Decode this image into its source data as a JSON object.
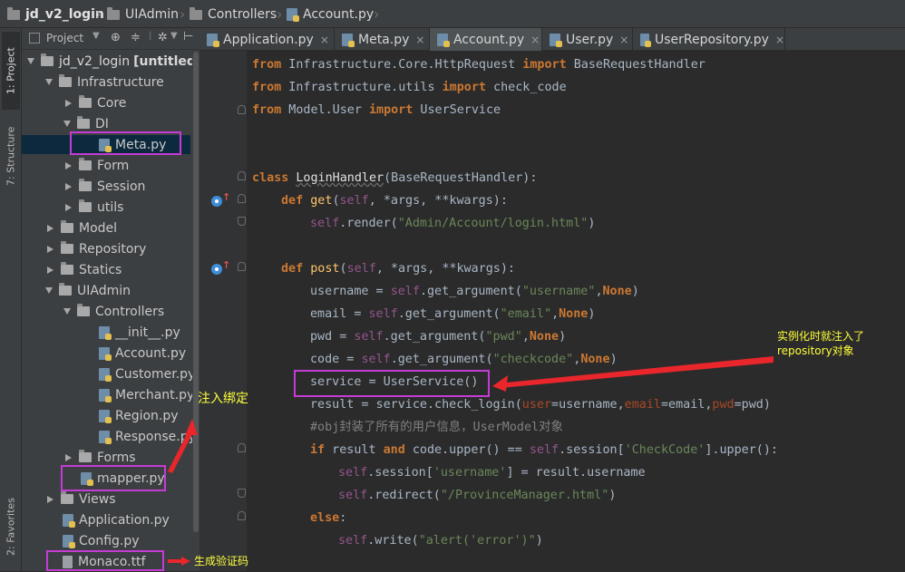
{
  "breadcrumb": [
    {
      "label": "jd_v2_login",
      "kind": "folder",
      "bold": true
    },
    {
      "label": "UIAdmin",
      "kind": "folder"
    },
    {
      "label": "Controllers",
      "kind": "folder"
    },
    {
      "label": "Account.py",
      "kind": "python-file"
    }
  ],
  "tool_stripe": {
    "project_tab": "1: Project",
    "structure_tab": "7: Structure",
    "favorites_tab": "2: Favorites"
  },
  "project_toolbar": {
    "label": "Project"
  },
  "tree": [
    {
      "label": "jd_v2_login",
      "suffix": "[untitled]",
      "type": "folder",
      "expanded": true
    },
    {
      "label": "Infrastructure",
      "type": "folder",
      "expanded": true
    },
    {
      "label": "Core",
      "type": "folder",
      "expanded": false
    },
    {
      "label": "DI",
      "type": "folder",
      "expanded": true
    },
    {
      "label": "Meta.py",
      "type": "python-file",
      "selected": true
    },
    {
      "label": "Form",
      "type": "folder",
      "expanded": false
    },
    {
      "label": "Session",
      "type": "folder",
      "expanded": false
    },
    {
      "label": "utils",
      "type": "folder",
      "expanded": false
    },
    {
      "label": "Model",
      "type": "folder",
      "expanded": false
    },
    {
      "label": "Repository",
      "type": "folder",
      "expanded": false
    },
    {
      "label": "Statics",
      "type": "folder",
      "expanded": false
    },
    {
      "label": "UIAdmin",
      "type": "folder",
      "expanded": true
    },
    {
      "label": "Controllers",
      "type": "folder",
      "expanded": true
    },
    {
      "label": "__init__.py",
      "type": "python-file"
    },
    {
      "label": "Account.py",
      "type": "python-file"
    },
    {
      "label": "Customer.py",
      "type": "python-file"
    },
    {
      "label": "Merchant.py",
      "type": "python-file"
    },
    {
      "label": "Region.py",
      "type": "python-file"
    },
    {
      "label": "Response.py",
      "type": "python-file"
    },
    {
      "label": "Forms",
      "type": "folder",
      "expanded": false
    },
    {
      "label": "mapper.py",
      "type": "python-file"
    },
    {
      "label": "Views",
      "type": "folder",
      "expanded": false
    },
    {
      "label": "Application.py",
      "type": "python-file"
    },
    {
      "label": "Config.py",
      "type": "python-file"
    },
    {
      "label": "Monaco.ttf",
      "type": "font-file"
    }
  ],
  "editor_tabs": [
    {
      "label": "Application.py",
      "active": false
    },
    {
      "label": "Meta.py",
      "active": false
    },
    {
      "label": "Account.py",
      "active": true
    },
    {
      "label": "User.py",
      "active": false
    },
    {
      "label": "UserRepository.py",
      "active": false
    }
  ],
  "tab_close_glyph": "×",
  "code": {
    "l1": {
      "kw1": "from",
      "mod": " Infrastructure.Core.HttpRequest ",
      "kw2": "import",
      "name": " BaseRequestHandler"
    },
    "l2": {
      "kw1": "from",
      "mod": " Infrastructure.utils ",
      "kw2": "import",
      "name": " check_code"
    },
    "l3": {
      "kw1": "from",
      "mod": " Model.User ",
      "kw2": "import",
      "name": " UserService"
    },
    "l4": {
      "kw": "class ",
      "name": "LoginHandler",
      "rest": "(BaseRequestHandler):"
    },
    "l5": {
      "kw": "def ",
      "name": "get",
      "p1": "(",
      "self": "self",
      "rest": ", *args, **kwargs):"
    },
    "l6": {
      "self": "self",
      "call": ".render(",
      "str": "\"Admin/Account/login.html\"",
      "close": ")"
    },
    "l7": {
      "kw": "def ",
      "name": "post",
      "p1": "(",
      "self": "self",
      "rest": ", *args, **kwargs):"
    },
    "l8": {
      "pre": "username = ",
      "self": "self",
      "call": ".get_argument(",
      "str": "\"username\"",
      "comma": ",",
      "kw": "None",
      "close": ")"
    },
    "l9": {
      "pre": "email = ",
      "self": "self",
      "call": ".get_argument(",
      "str": "\"email\"",
      "comma": ",",
      "kw": "None",
      "close": ")"
    },
    "l10": {
      "pre": "pwd = ",
      "self": "self",
      "call": ".get_argument(",
      "str": "\"pwd\"",
      "comma": ",",
      "kw": "None",
      "close": ")"
    },
    "l11": {
      "pre": "code = ",
      "self": "self",
      "call": ".get_argument(",
      "str": "\"checkcode\"",
      "comma": ",",
      "kw": "None",
      "close": ")"
    },
    "l12": {
      "text": "service = UserService()"
    },
    "l13": {
      "pre": "result = service.check_login(",
      "a1": "user",
      "e1": "=username,",
      "a2": "email",
      "e2": "=email,",
      "a3": "pwd",
      "e3": "=pwd)"
    },
    "l14": {
      "text": "#obj封装了所有的用户信息，UserModel对象"
    },
    "l15": {
      "kw1": "if",
      "mid1": " result ",
      "kw2": "and",
      "mid2": " code.upper() == ",
      "self": "self",
      "call": ".session[",
      "str": "'CheckCode'",
      "rest": "].upper():"
    },
    "l16": {
      "self": "self",
      "call": ".session[",
      "str": "'username'",
      "rest": "] = result.username"
    },
    "l17": {
      "self": "self",
      "call": ".redirect(",
      "str": "\"/ProvinceManager.html\"",
      "close": ")"
    },
    "l18": {
      "kw": "else",
      "rest": ":"
    },
    "l19": {
      "self": "self",
      "call": ".write(",
      "str": "\"alert('error')\"",
      "close": ")"
    }
  },
  "annotations": {
    "instantiate_note_line1": "实例化时就注入了",
    "instantiate_note_line2": "repository对象",
    "inject_binding_note": "注入绑定",
    "captcha_note": "生成验证码"
  },
  "colors": {
    "highlight_box": "#c43bd6",
    "annotation_text": "#ffff3a",
    "annotation_arrow": "#e8262b"
  }
}
